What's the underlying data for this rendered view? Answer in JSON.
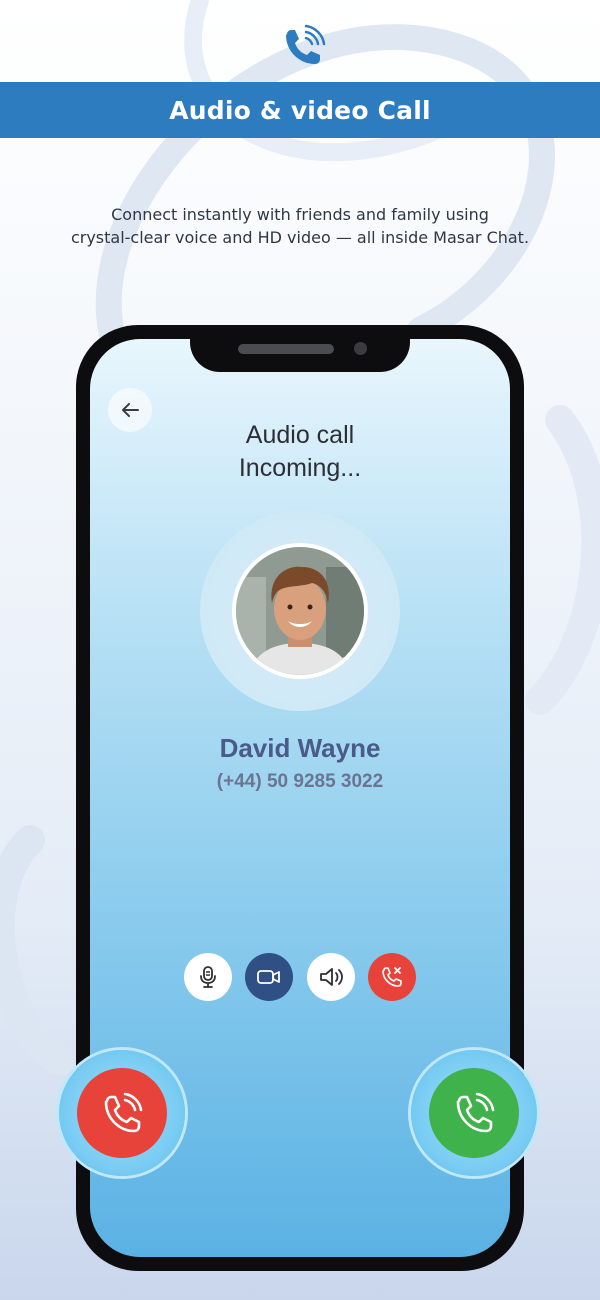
{
  "header": {
    "icon": "phone-ringing-icon",
    "title": "Audio & video Call"
  },
  "description": {
    "line1": "Connect instantly with friends and family using",
    "line2": "crystal-clear voice and HD video — all inside Masar Chat."
  },
  "call_screen": {
    "back_icon": "arrow-left-icon",
    "call_type": "Audio call",
    "status": "Incoming...",
    "contact": {
      "name": "David Wayne",
      "phone": "(+44) 50 9285 3022"
    },
    "controls": [
      {
        "name": "mute-button",
        "icon": "microphone-icon"
      },
      {
        "name": "video-button",
        "icon": "video-camera-icon"
      },
      {
        "name": "speaker-button",
        "icon": "speaker-icon"
      },
      {
        "name": "end-call-button",
        "icon": "phone-x-icon"
      }
    ]
  },
  "actions": {
    "decline_icon": "phone-decline-icon",
    "accept_icon": "phone-accept-icon"
  },
  "colors": {
    "banner": "#2e7cc0",
    "decline": "#e8433b",
    "accept": "#3fb24c",
    "video_button": "#2f4f85",
    "name_text": "#4a5a8a"
  }
}
